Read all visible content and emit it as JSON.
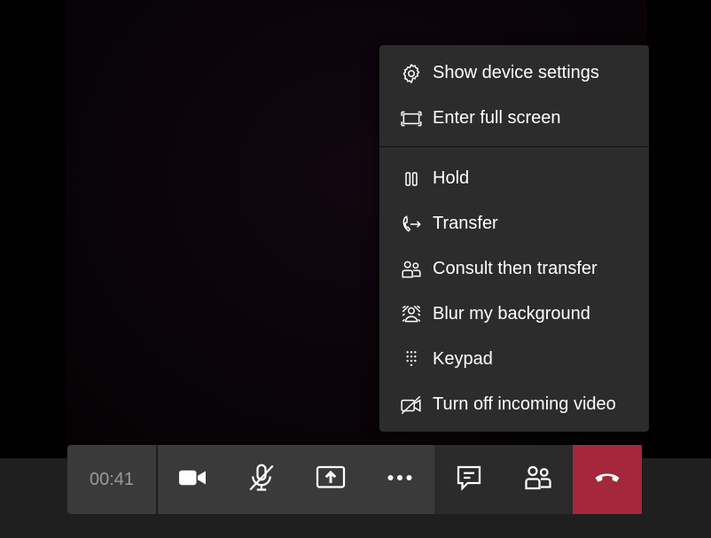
{
  "menu": {
    "items": [
      {
        "label": "Show device settings",
        "icon": "gear-icon"
      },
      {
        "label": "Enter full screen",
        "icon": "fullscreen-icon"
      },
      {
        "label": "Hold",
        "icon": "pause-icon"
      },
      {
        "label": "Transfer",
        "icon": "transfer-icon"
      },
      {
        "label": "Consult then transfer",
        "icon": "people-icon"
      },
      {
        "label": "Blur my background",
        "icon": "blur-icon"
      },
      {
        "label": "Keypad",
        "icon": "keypad-icon"
      },
      {
        "label": "Turn off incoming video",
        "icon": "video-off-icon"
      }
    ]
  },
  "callbar": {
    "timer": "00:41",
    "buttons": [
      "camera-icon",
      "mic-off-icon",
      "share-screen-icon",
      "more-icon",
      "chat-icon",
      "participants-icon",
      "hang-up-icon"
    ]
  },
  "colors": {
    "menu_bg": "#2d2c2c",
    "callbar_bg": "#3a3a3a",
    "callbar_dark": "#2b2b2b",
    "hangup": "#a4273b",
    "timer_text": "#9a9a9a"
  }
}
